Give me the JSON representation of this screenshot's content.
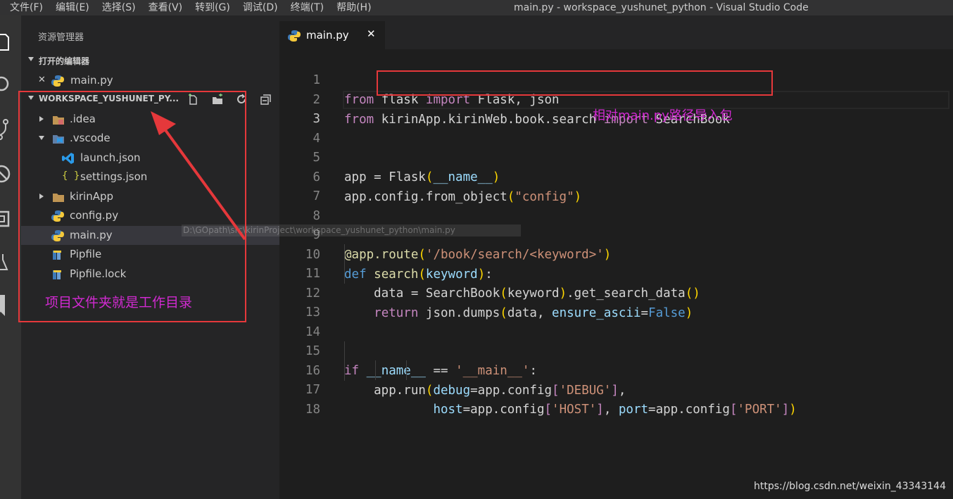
{
  "menu": [
    "文件(F)",
    "编辑(E)",
    "选择(S)",
    "查看(V)",
    "转到(G)",
    "调试(D)",
    "终端(T)",
    "帮助(H)"
  ],
  "window_title": "main.py - workspace_yushunet_python - Visual Studio Code",
  "activity_icons": [
    "explorer-icon",
    "search-icon",
    "source-control-icon",
    "debug-icon",
    "extensions-icon",
    "test-icon",
    "bookmark-icon"
  ],
  "sidebar": {
    "title": "资源管理器",
    "open_editors": {
      "header": "打开的编辑器",
      "items": [
        {
          "label": "main.py",
          "close": "✕"
        }
      ]
    },
    "workspace": {
      "header": "WORKSPACE_YUSHUNET_PY...",
      "tree": [
        {
          "label": ".idea",
          "icon": "folder-idea-icon",
          "kind": "folder",
          "expanded": false
        },
        {
          "label": ".vscode",
          "icon": "folder-vscode-icon",
          "kind": "folder",
          "expanded": true
        },
        {
          "label": "launch.json",
          "icon": "vscode-file-icon",
          "kind": "file"
        },
        {
          "label": "settings.json",
          "icon": "json-braces-icon",
          "kind": "file"
        },
        {
          "label": "kirinApp",
          "icon": "folder-icon",
          "kind": "folder",
          "expanded": false
        },
        {
          "label": "config.py",
          "icon": "python-icon",
          "kind": "file"
        },
        {
          "label": "main.py",
          "icon": "python-icon",
          "kind": "file",
          "selected": true
        },
        {
          "label": "Pipfile",
          "icon": "pipfile-icon",
          "kind": "file"
        },
        {
          "label": "Pipfile.lock",
          "icon": "pipfile-icon",
          "kind": "file"
        }
      ]
    },
    "ghost_path": "D:\\GOpath\\src\\kirinProject\\workspace_yushunet_python\\main.py",
    "annotation": "项目文件夹就是工作目录"
  },
  "editor": {
    "tab": {
      "label": "main.py",
      "close": "✕"
    },
    "annotation": "相对main.py路径导入包",
    "lines": [
      {
        "n": "1",
        "code": "from flask import Flask, json"
      },
      {
        "n": "2",
        "code": "from kirinApp.kirinWeb.book.search import SearchBook"
      },
      {
        "n": "3",
        "code": ""
      },
      {
        "n": "4",
        "code": ""
      },
      {
        "n": "5",
        "code": "app = Flask(__name__)"
      },
      {
        "n": "6",
        "code": "app.config.from_object(\"config\")"
      },
      {
        "n": "7",
        "code": ""
      },
      {
        "n": "8",
        "code": ""
      },
      {
        "n": "9",
        "code": "@app.route('/book/search/<keyword>')"
      },
      {
        "n": "10",
        "code": "def search(keyword):"
      },
      {
        "n": "11",
        "code": "    data = SearchBook(keyword).get_search_data()"
      },
      {
        "n": "12",
        "code": "    return json.dumps(data, ensure_ascii=False)"
      },
      {
        "n": "13",
        "code": ""
      },
      {
        "n": "14",
        "code": ""
      },
      {
        "n": "15",
        "code": "if __name__ == '__main__':"
      },
      {
        "n": "16",
        "code": "    app.run(debug=app.config['DEBUG'],"
      },
      {
        "n": "17",
        "code": "            host=app.config['HOST'], port=app.config['PORT'])"
      },
      {
        "n": "18",
        "code": ""
      }
    ],
    "current_line": "3"
  },
  "watermark": "https://blog.csdn.net/weixin_43343144",
  "colors": {
    "annotation": "#d12ad1",
    "highlight_box": "#e5383b",
    "keyword": "#c586c0",
    "string": "#ce9178"
  }
}
